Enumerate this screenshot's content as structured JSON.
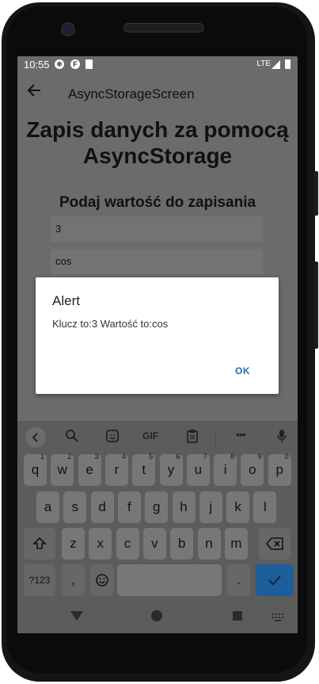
{
  "status_bar": {
    "time": "10:55",
    "network": "LTE"
  },
  "app_bar": {
    "title": "AsyncStorageScreen"
  },
  "content": {
    "heading_line1": "Zapis danych za pomocą",
    "heading_line2": "AsyncStorage",
    "subheading": "Podaj wartość do zapisania",
    "input_key_value": "3",
    "input_value_value": "cos"
  },
  "dialog": {
    "title": "Alert",
    "message": "Klucz to:3 Wartość to:cos",
    "ok_label": "OK"
  },
  "keyboard": {
    "toolbar": {
      "gif_label": "GIF",
      "more_label": "•••"
    },
    "row1": [
      {
        "k": "q",
        "h": "1"
      },
      {
        "k": "w",
        "h": "2"
      },
      {
        "k": "e",
        "h": "3"
      },
      {
        "k": "r",
        "h": "4"
      },
      {
        "k": "t",
        "h": "5"
      },
      {
        "k": "y",
        "h": "6"
      },
      {
        "k": "u",
        "h": "7"
      },
      {
        "k": "i",
        "h": "8"
      },
      {
        "k": "o",
        "h": "9"
      },
      {
        "k": "p",
        "h": "0"
      }
    ],
    "row2": [
      "a",
      "s",
      "d",
      "f",
      "g",
      "h",
      "j",
      "k",
      "l"
    ],
    "row3": [
      "z",
      "x",
      "c",
      "v",
      "b",
      "n",
      "m"
    ],
    "symbols_label": "?123",
    "comma_label": ",",
    "period_label": "."
  },
  "colors": {
    "accent": "#1e6fb0",
    "enter_key": "#1d5d9a",
    "scrim": "#6b6b6b"
  }
}
